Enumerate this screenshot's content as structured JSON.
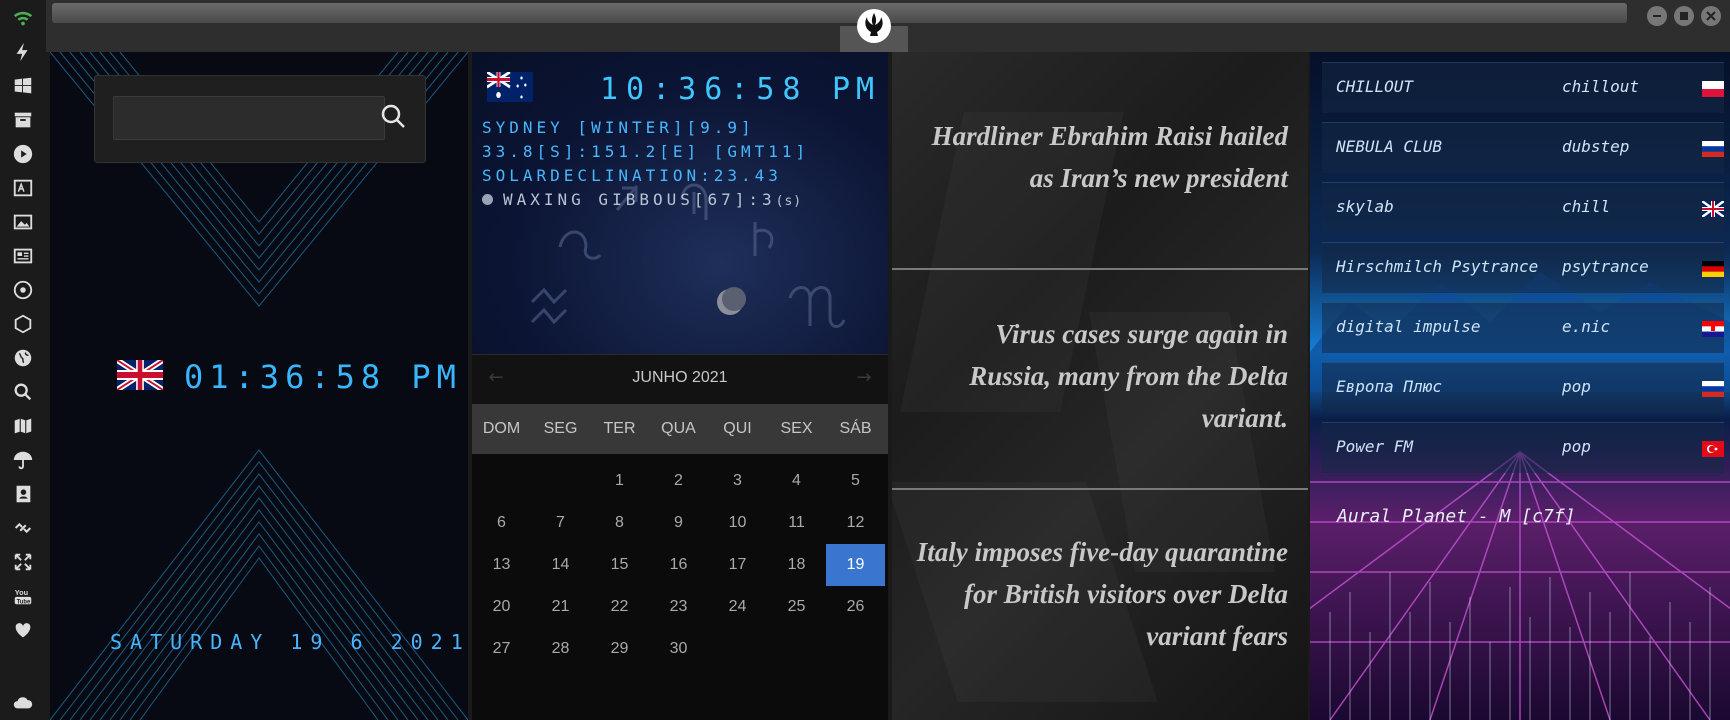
{
  "sidebar": {
    "icons": [
      "wifi-icon",
      "lightning-icon",
      "windows-icon",
      "archive-icon",
      "play-icon",
      "translate-icon",
      "image-icon",
      "news-icon",
      "settings-icon",
      "hexagon-icon",
      "globe-icon",
      "search-icon",
      "map-icon",
      "umbrella-icon",
      "contacts-icon",
      "link-icon",
      "fullscreen-icon",
      "youtube-icon",
      "heart-icon",
      "cloud-icon"
    ],
    "accent": "#4caf50"
  },
  "window": {
    "logo": "rebel-alliance-icon",
    "controls": [
      "minimize-icon",
      "maximize-icon",
      "close-icon"
    ]
  },
  "search": {
    "value": "",
    "icon": "magnifier-icon"
  },
  "clock_uk": {
    "flag": "uk-flag",
    "time": "01:36:58 PM",
    "date": "SATURDAY 19 6 2021"
  },
  "clock_au": {
    "flag": "australia-flag",
    "time": "10:36:58",
    "ampm": "PM",
    "location": "SYDNEY [WINTER][9.9]",
    "coords": "33.8[S]:151.2[E] [GMT11]",
    "solar": "SOLARDECLINATION:23.43",
    "moon": "WAXING GIBBOUS[67]:3",
    "moon_suffix": "(s)"
  },
  "calendar": {
    "title": "JUNHO 2021",
    "weekdays": [
      "DOM",
      "SEG",
      "TER",
      "QUA",
      "QUI",
      "SEX",
      "SÁB"
    ],
    "weeks": [
      [
        "",
        "",
        "1",
        "2",
        "3",
        "4",
        "5"
      ],
      [
        "6",
        "7",
        "8",
        "9",
        "10",
        "11",
        "12"
      ],
      [
        "13",
        "14",
        "15",
        "16",
        "17",
        "18",
        "19"
      ],
      [
        "20",
        "21",
        "22",
        "23",
        "24",
        "25",
        "26"
      ],
      [
        "27",
        "28",
        "29",
        "30",
        "",
        "",
        ""
      ]
    ],
    "today": "19",
    "today_color": "#3a76d0"
  },
  "news": [
    {
      "headline": "Hardliner Ebrahim Raisi hailed as Iran’s new president"
    },
    {
      "headline": "Virus cases surge again in Russia, many from the Delta variant."
    },
    {
      "headline": "Italy imposes five-day quarantine for British visitors over Delta variant fears"
    }
  ],
  "radio": {
    "stations": [
      {
        "name": "CHILLOUT",
        "genre": "chillout",
        "flag": "poland-flag"
      },
      {
        "name": "NEBULA CLUB",
        "genre": "dubstep",
        "flag": "russia-flag"
      },
      {
        "name": "skylab",
        "genre": "chill",
        "flag": "uk-flag"
      },
      {
        "name": "Hirschmilch Psytrance",
        "genre": "psytrance",
        "flag": "germany-flag"
      },
      {
        "name": "digital impulse",
        "genre": "e.nic",
        "flag": "croatia-flag"
      },
      {
        "name": "Европа Плюс",
        "genre": "pop",
        "flag": "russia-flag"
      },
      {
        "name": "Power FM",
        "genre": "pop",
        "flag": "turkey-flag"
      }
    ],
    "now_playing": "Aural Planet - M [c7f]"
  }
}
